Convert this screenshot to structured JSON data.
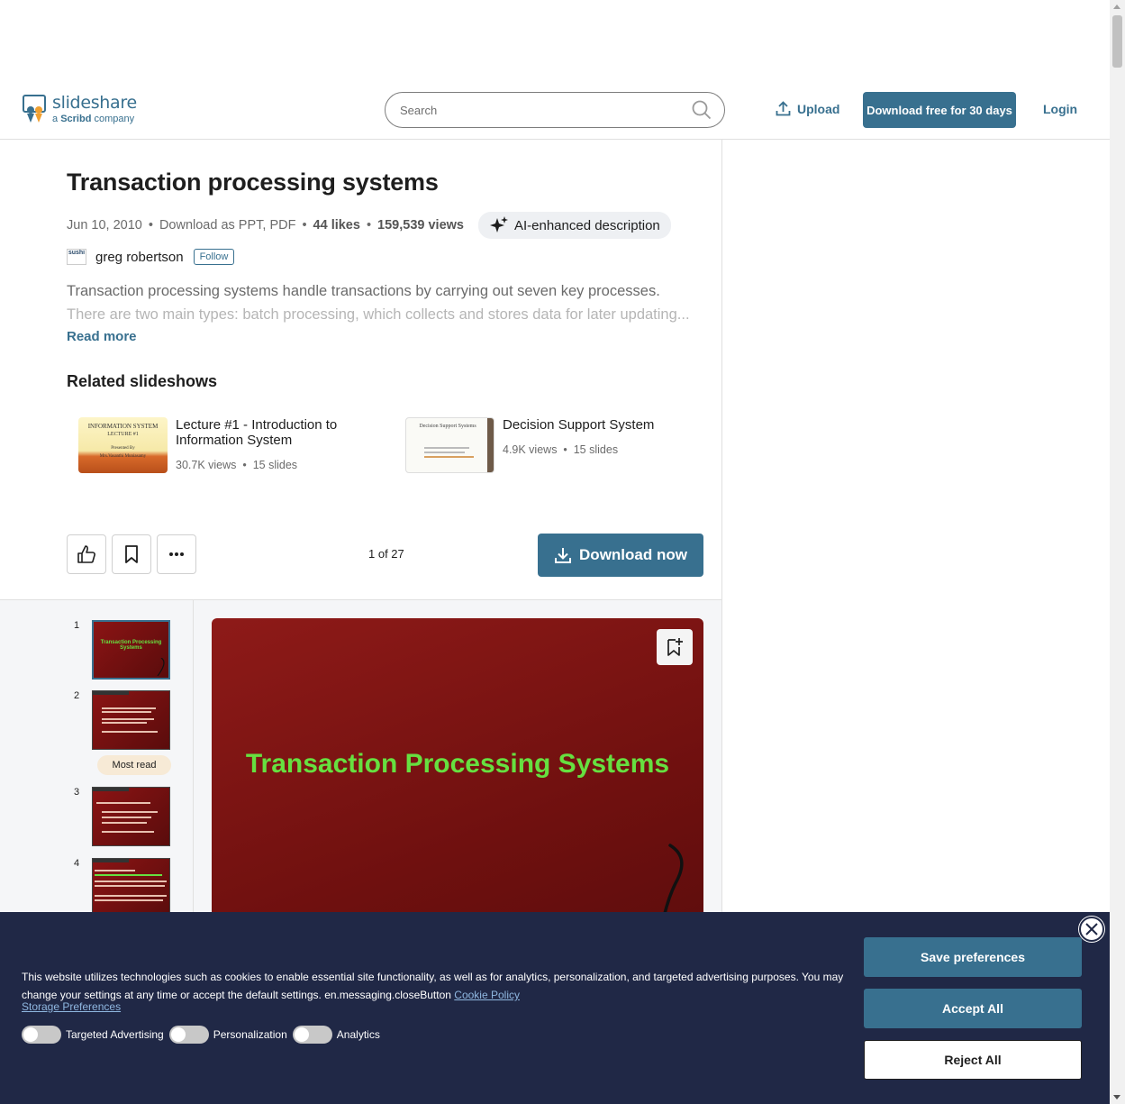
{
  "header": {
    "logo_name": "slideshare",
    "logo_sub_prefix": "a",
    "logo_sub_brand": "Scribd",
    "logo_sub_suffix": "company",
    "search_placeholder": "Search",
    "upload_label": "Upload",
    "download_free_label": "Download free for 30 days",
    "login_label": "Login"
  },
  "document": {
    "title": "Transaction processing systems",
    "date": "Jun 10, 2010",
    "download_as": "Download as PPT, PDF",
    "likes": "44 likes",
    "views": "159,539 views",
    "ai_badge": "AI-enhanced description",
    "author": "greg robertson",
    "avatar_text": "sushi",
    "follow_label": "Follow",
    "description_line1": "Transaction processing systems handle transactions by carrying out seven key processes.",
    "description_line2": "There are two main types: batch processing, which collects and stores data for later updating...",
    "read_more": "Read more"
  },
  "related": {
    "heading": "Related slideshows",
    "items": [
      {
        "title": "Lecture #1 - Introduction to Information System",
        "views": "30.7K views",
        "slides": "15 slides",
        "thumb_line1": "INFORMATION SYSTEM",
        "thumb_line2": "LECTURE #1",
        "thumb_line3": "Presented By",
        "thumb_line4": "Mrs.Vasanthi Muniasamy"
      },
      {
        "title": "Decision Support System",
        "views": "4.9K views",
        "slides": "15 slides",
        "thumb_line1": "Decision Support Systems"
      }
    ]
  },
  "toolbar": {
    "page_count": "1 of 27",
    "download_now": "Download now"
  },
  "viewer": {
    "thumbnails": [
      {
        "num": "1",
        "text": "Transaction Processing Systems"
      },
      {
        "num": "2"
      },
      {
        "num": "3"
      },
      {
        "num": "4"
      }
    ],
    "most_read": "Most read",
    "slide_title": "Transaction Processing Systems"
  },
  "cookie": {
    "text": "This website utilizes technologies such as cookies to enable essential site functionality, as well as for analytics, personalization, and targeted advertising purposes. You may change your settings at any time or accept the default settings. en.messaging.closeButton",
    "cookie_policy": "Cookie Policy",
    "storage_prefs": "Storage Preferences",
    "toggles": [
      "Targeted Advertising",
      "Personalization",
      "Analytics"
    ],
    "save_label": "Save preferences",
    "accept_label": "Accept All",
    "reject_label": "Reject All"
  },
  "colors": {
    "brand": "#38708f",
    "slide_bg": "#7a1212",
    "slide_title": "#66e040",
    "banner_bg": "#202846"
  }
}
